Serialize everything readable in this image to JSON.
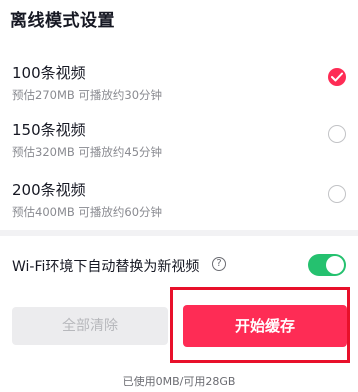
{
  "page": {
    "title": "离线模式设置"
  },
  "options": [
    {
      "label": "100条视频",
      "sub": "预估270MB 可播放约30分钟",
      "selected": true
    },
    {
      "label": "150条视频",
      "sub": "预估320MB 可播放约45分钟",
      "selected": false
    },
    {
      "label": "200条视频",
      "sub": "预估400MB 可播放约60分钟",
      "selected": false
    }
  ],
  "wifi": {
    "label": "Wi-Fi环境下自动替换为新视频",
    "help_symbol": "?",
    "enabled": true
  },
  "actions": {
    "clear_label": "全部清除",
    "start_label": "开始缓存"
  },
  "storage": {
    "text": "已使用0MB/可用28GB"
  },
  "colors": {
    "accent": "#fe2c55",
    "toggle_on": "#25c16f",
    "highlight": "#e8102a"
  }
}
